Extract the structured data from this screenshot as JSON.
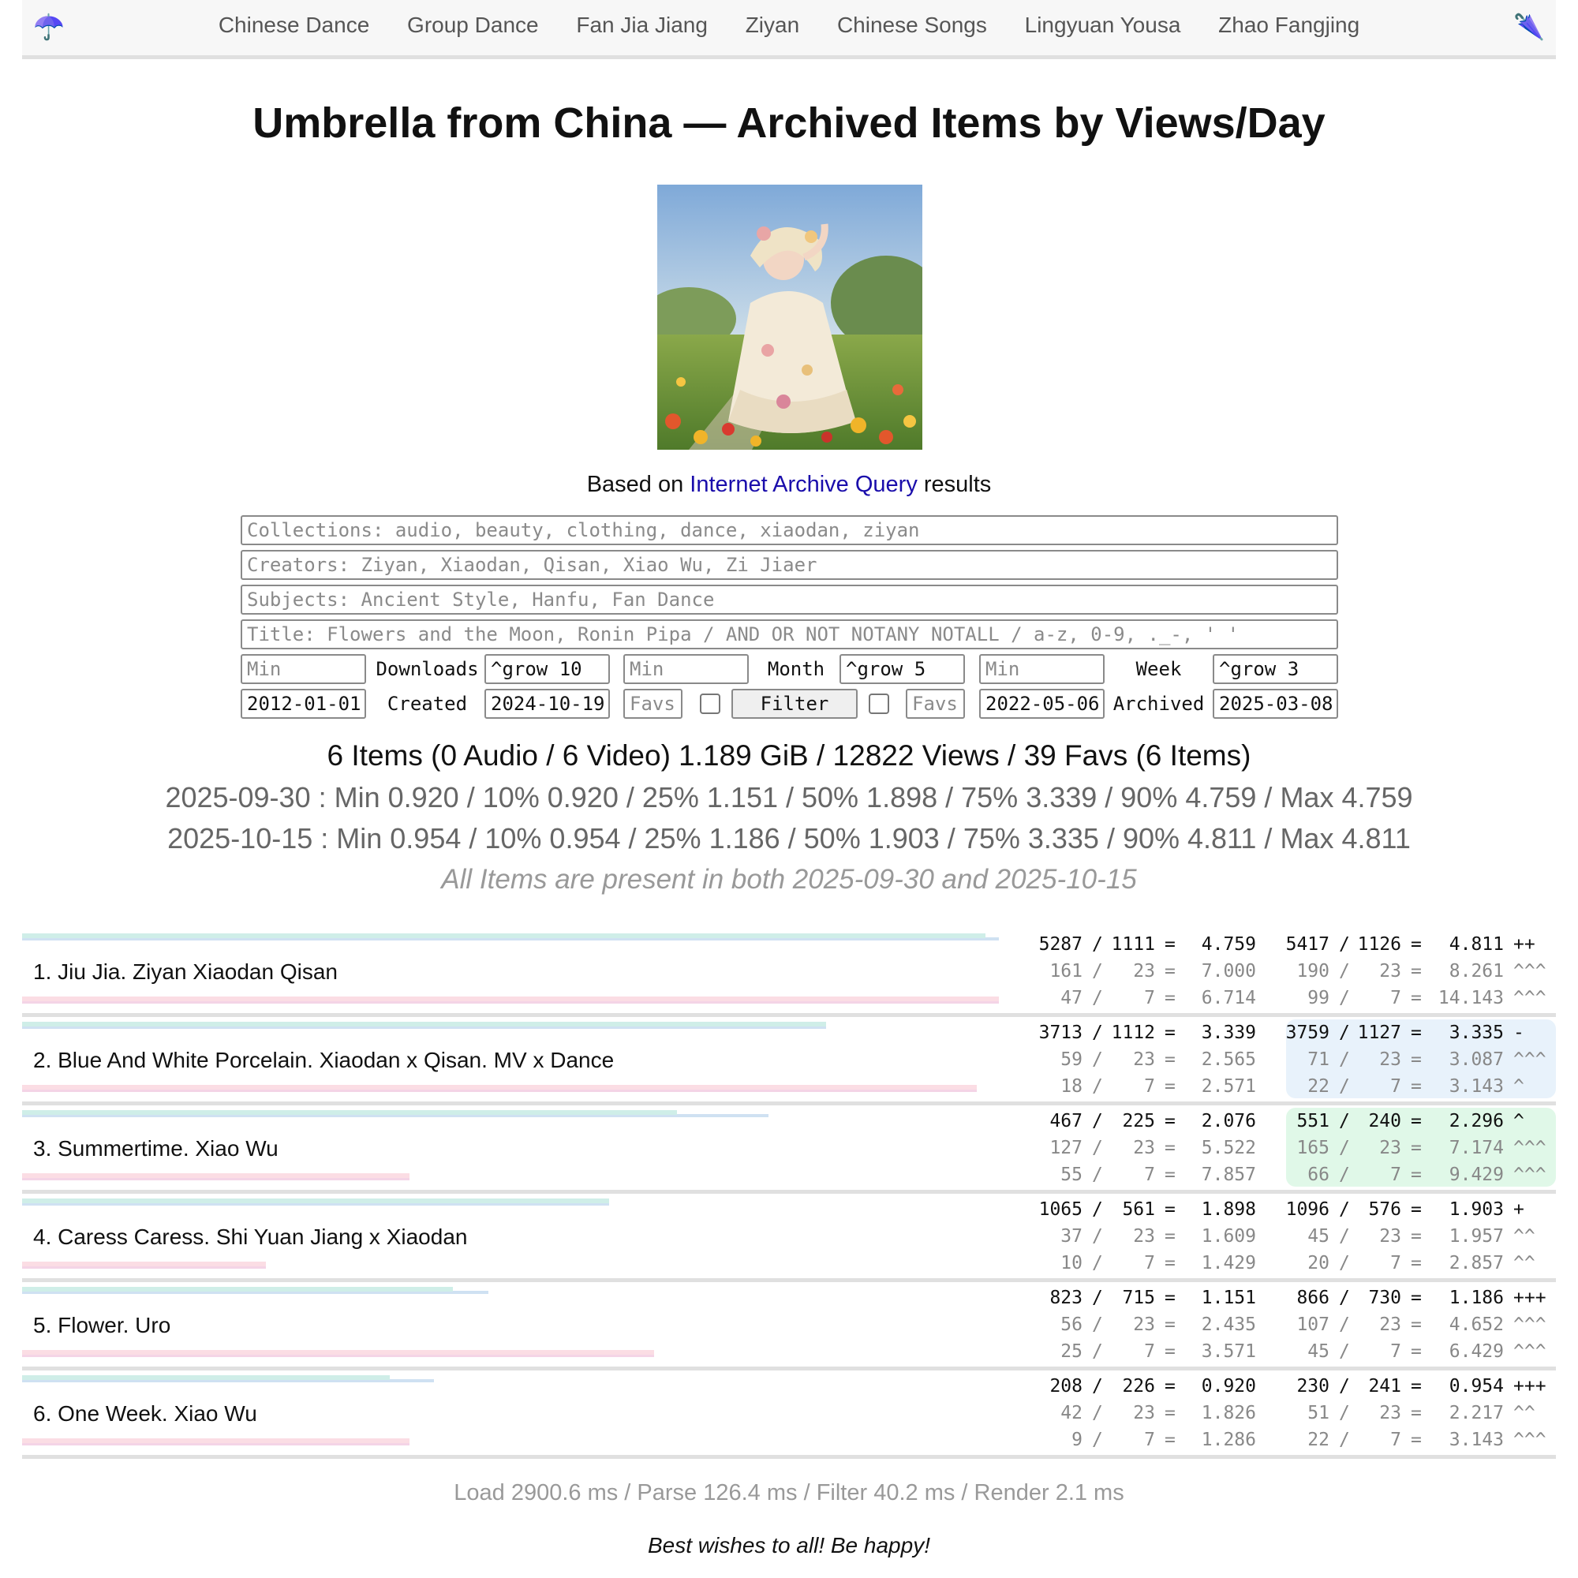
{
  "nav": {
    "logo_left": "☂️",
    "logo_right": "🌂",
    "links": [
      "Chinese Dance",
      "Group Dance",
      "Fan Jia Jiang",
      "Ziyan",
      "Chinese Songs",
      "Lingyuan Yousa",
      "Zhao Fangjing"
    ]
  },
  "page_title": "Umbrella from China — Archived Items by Views/Day",
  "based_on": {
    "prefix": "Based on",
    "link": "Internet Archive Query",
    "suffix": "results"
  },
  "filters": {
    "collections_placeholder": "Collections: audio, beauty, clothing, dance, xiaodan, ziyan",
    "creators_placeholder": "Creators: Ziyan, Xiaodan, Qisan, Xiao Wu, Zi Jiaer",
    "subjects_placeholder": "Subjects: Ancient Style, Hanfu, Fan Dance",
    "title_placeholder": "Title: Flowers and the Moon, Ronin Pipa / AND OR NOT NOTANY NOTALL / a-z, 0-9, ._-, ' '",
    "min_placeholder": "Min",
    "downloads_label": "Downloads",
    "downloads_grow": "^grow 10",
    "month_label": "Month",
    "month_grow": "^grow 5",
    "week_label": "Week",
    "week_grow": "^grow 3",
    "created_from": "2012-01-01",
    "created_label": "Created",
    "created_to": "2024-10-19",
    "favs_placeholder": "Favs",
    "filter_button": "Filter",
    "archived_from": "2022-05-06",
    "archived_label": "Archived",
    "archived_to": "2025-03-08"
  },
  "summary": "6 Items (0 Audio / 6 Video) 1.189 GiB / 12822 Views / 39 Favs (6 Items)",
  "stats": [
    "2025-09-30 : Min 0.920 / 10% 0.920 / 25% 1.151 / 50% 1.898 / 75% 3.339 / 90% 4.759 / Max 4.759",
    "2025-10-15 : Min 0.954 / 10% 0.954 / 25% 1.186 / 50% 1.903 / 75% 3.335 / 90% 4.811 / Max 4.811"
  ],
  "note": "All Items are present in both 2025-09-30 and 2025-10-15",
  "colors": {
    "green_highlight": "#e0f8e8",
    "blue_highlight": "#e8f2fb"
  },
  "items": [
    {
      "name": "1. Jiu Jia. Ziyan Xiaodan Qisan",
      "highlight": "none",
      "bars": {
        "top1": 0.967,
        "top2": 0.98,
        "bot1": 0.98,
        "bot2": 0.98
      },
      "rows": [
        [
          "5287",
          "/",
          "1111",
          "=",
          "4.759",
          "5417",
          "/",
          "1126",
          "=",
          "4.811",
          "++"
        ],
        [
          "161",
          "/",
          "23",
          "=",
          "7.000",
          "190",
          "/",
          "23",
          "=",
          "8.261",
          "^^^"
        ],
        [
          "47",
          "/",
          "7",
          "=",
          "6.714",
          "99",
          "/",
          "7",
          "=",
          "14.143",
          "^^^"
        ]
      ]
    },
    {
      "name": "2. Blue And White Porcelain. Xiaodan x Qisan. MV x Dance",
      "highlight": "blue",
      "bars": {
        "top1": 0.807,
        "top2": 0.807,
        "bot1": 0.958,
        "bot2": 0.958
      },
      "rows": [
        [
          "3713",
          "/",
          "1112",
          "=",
          "3.339",
          "3759",
          "/",
          "1127",
          "=",
          "3.335",
          "-"
        ],
        [
          "59",
          "/",
          "23",
          "=",
          "2.565",
          "71",
          "/",
          "23",
          "=",
          "3.087",
          "^^^"
        ],
        [
          "18",
          "/",
          "7",
          "=",
          "2.571",
          "22",
          "/",
          "7",
          "=",
          "3.143",
          "^"
        ]
      ]
    },
    {
      "name": "3. Summertime. Xiao Wu",
      "highlight": "green",
      "bars": {
        "top1": 0.657,
        "top2": 0.749,
        "bot1": 0.389,
        "bot2": 0.389
      },
      "rows": [
        [
          "467",
          "/",
          "225",
          "=",
          "2.076",
          "551",
          "/",
          "240",
          "=",
          "2.296",
          "^"
        ],
        [
          "127",
          "/",
          "23",
          "=",
          "5.522",
          "165",
          "/",
          "23",
          "=",
          "7.174",
          "^^^"
        ],
        [
          "55",
          "/",
          "7",
          "=",
          "7.857",
          "66",
          "/",
          "7",
          "=",
          "9.429",
          "^^^"
        ]
      ]
    },
    {
      "name": "4. Caress Caress. Shi Yuan Jiang x Xiaodan",
      "highlight": "none",
      "bars": {
        "top1": 0.589,
        "top2": 0.589,
        "bot1": 0.245,
        "bot2": 0.245
      },
      "rows": [
        [
          "1065",
          "/",
          "561",
          "=",
          "1.898",
          "1096",
          "/",
          "576",
          "=",
          "1.903",
          "+"
        ],
        [
          "37",
          "/",
          "23",
          "=",
          "1.609",
          "45",
          "/",
          "23",
          "=",
          "1.957",
          "^^"
        ],
        [
          "10",
          "/",
          "7",
          "=",
          "1.429",
          "20",
          "/",
          "7",
          "=",
          "2.857",
          "^^"
        ]
      ]
    },
    {
      "name": "5. Flower. Uro",
      "highlight": "none",
      "bars": {
        "top1": 0.432,
        "top2": 0.468,
        "bot1": 0.634,
        "bot2": 0.634
      },
      "rows": [
        [
          "823",
          "/",
          "715",
          "=",
          "1.151",
          "866",
          "/",
          "730",
          "=",
          "1.186",
          "+++"
        ],
        [
          "56",
          "/",
          "23",
          "=",
          "2.435",
          "107",
          "/",
          "23",
          "=",
          "4.652",
          "^^^"
        ],
        [
          "25",
          "/",
          "7",
          "=",
          "3.571",
          "45",
          "/",
          "7",
          "=",
          "6.429",
          "^^^"
        ]
      ]
    },
    {
      "name": "6. One Week. Xiao Wu",
      "highlight": "none",
      "bars": {
        "top1": 0.369,
        "top2": 0.413,
        "bot1": 0.389,
        "bot2": 0.389
      },
      "rows": [
        [
          "208",
          "/",
          "226",
          "=",
          "0.920",
          "230",
          "/",
          "241",
          "=",
          "0.954",
          "+++"
        ],
        [
          "42",
          "/",
          "23",
          "=",
          "1.826",
          "51",
          "/",
          "23",
          "=",
          "2.217",
          "^^"
        ],
        [
          "9",
          "/",
          "7",
          "=",
          "1.286",
          "22",
          "/",
          "7",
          "=",
          "3.143",
          "^^^"
        ]
      ]
    }
  ],
  "timing": "Load 2900.6 ms / Parse 126.4 ms / Filter 40.2 ms / Render 2.1 ms",
  "wishes": "Best wishes to all! Be happy!"
}
